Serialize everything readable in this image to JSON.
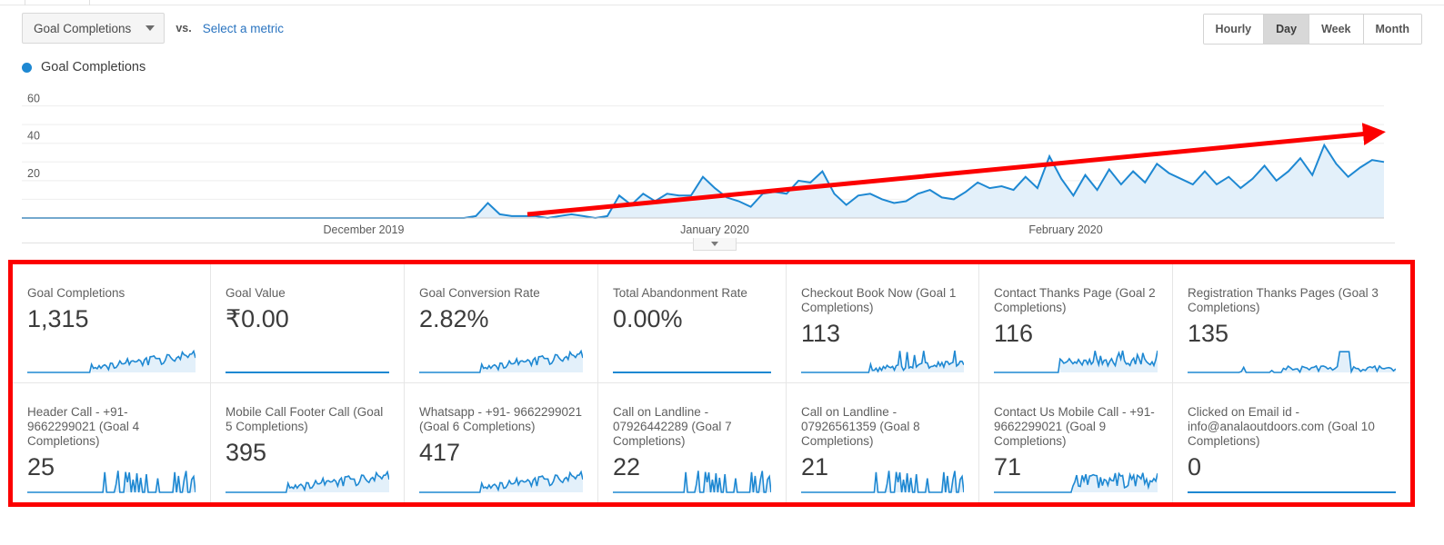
{
  "toolbar": {
    "metric_select_label": "Goal Completions",
    "vs_label": "vs.",
    "select_metric_label": "Select a metric",
    "caret_icon": "chevron-down-icon",
    "granularity": [
      {
        "label": "Hourly",
        "active": false
      },
      {
        "label": "Day",
        "active": true
      },
      {
        "label": "Week",
        "active": false
      },
      {
        "label": "Month",
        "active": false
      }
    ]
  },
  "legend": {
    "series_label": "Goal Completions",
    "color": "#1e88d2"
  },
  "annotation": {
    "type": "trend-arrow",
    "color": "#fc0000",
    "description": "red upward trend arrow over chart"
  },
  "highlight_box": {
    "color": "#fc0000",
    "description": "red rectangle around metric cards"
  },
  "chart_data": {
    "type": "area",
    "title": "Goal Completions",
    "xlabel": "",
    "ylabel": "",
    "ylim": [
      0,
      70
    ],
    "yticks": [
      20,
      40,
      60
    ],
    "ytick_labels": [
      "20",
      "40",
      "60"
    ],
    "grid": true,
    "legend_position": "top-left",
    "line_color": "#1e88d2",
    "fill_color": "#e3f0fa",
    "xtick_labels": [
      "December 2019",
      "January 2020",
      "February 2020"
    ],
    "series": [
      {
        "name": "Goal Completions",
        "values": [
          0,
          0,
          0,
          0,
          0,
          0,
          0,
          0,
          0,
          0,
          0,
          0,
          0,
          0,
          0,
          0,
          0,
          0,
          0,
          0,
          0,
          0,
          0,
          0,
          0,
          0,
          0,
          0,
          0,
          0,
          0,
          0,
          0,
          0,
          0,
          0,
          0,
          0,
          1,
          8,
          2,
          1,
          1,
          1,
          0,
          1,
          2,
          1,
          0,
          1,
          12,
          7,
          13,
          9,
          13,
          12,
          12,
          22,
          16,
          11,
          9,
          6,
          13,
          14,
          13,
          20,
          19,
          25,
          13,
          7,
          12,
          13,
          10,
          8,
          9,
          13,
          15,
          11,
          10,
          14,
          19,
          16,
          17,
          15,
          22,
          16,
          33,
          21,
          12,
          23,
          15,
          26,
          18,
          25,
          19,
          29,
          24,
          21,
          18,
          25,
          18,
          22,
          16,
          21,
          28,
          20,
          25,
          32,
          23,
          39,
          29,
          22,
          27,
          31,
          30
        ]
      }
    ],
    "collapse_handle_icon": "chevron-down-icon"
  },
  "cards": {
    "row1": [
      {
        "title": "Goal Completions",
        "value": "1,315",
        "spark": "rising-noisy",
        "flat": false
      },
      {
        "title": "Goal Value",
        "value": "₹0.00",
        "spark": "flat",
        "flat": true
      },
      {
        "title": "Goal Conversion Rate",
        "value": "2.82%",
        "spark": "rising-noisy",
        "flat": false
      },
      {
        "title": "Total Abandonment Rate",
        "value": "0.00%",
        "spark": "flat",
        "flat": true
      },
      {
        "title": "Checkout Book Now (Goal 1 Completions)",
        "value": "113",
        "spark": "rising-spiky",
        "flat": false
      },
      {
        "title": "Contact Thanks Page (Goal 2 Completions)",
        "value": "116",
        "spark": "mid-noisy",
        "flat": false
      },
      {
        "title": "Registration Thanks Pages (Goal 3 Completions)",
        "value": "135",
        "spark": "late-spike",
        "flat": false
      }
    ],
    "row2": [
      {
        "title": "Header Call - +91- 9662299021 (Goal 4 Completions)",
        "value": "25",
        "spark": "sparse-spikes",
        "flat": false
      },
      {
        "title": "Mobile Call Footer Call (Goal 5 Completions)",
        "value": "395",
        "spark": "rising-dense",
        "flat": false
      },
      {
        "title": "Whatsapp - +91- 9662299021 (Goal 6 Completions)",
        "value": "417",
        "spark": "rising-dense",
        "flat": false
      },
      {
        "title": "Call on Landline - 07926442289 (Goal 7 Completions)",
        "value": "22",
        "spark": "sparse-spikes",
        "flat": false
      },
      {
        "title": "Call on Landline - 07926561359 (Goal 8 Completions)",
        "value": "21",
        "spark": "sparse-spikes",
        "flat": false
      },
      {
        "title": "Contact Us Mobile Call - +91- 9662299021 (Goal 9 Completions)",
        "value": "71",
        "spark": "late-dense",
        "flat": false
      },
      {
        "title": "Clicked on Email id - info@analaoutdoors.com (Goal 10 Completions)",
        "value": "0",
        "spark": "flat",
        "flat": true
      }
    ]
  }
}
